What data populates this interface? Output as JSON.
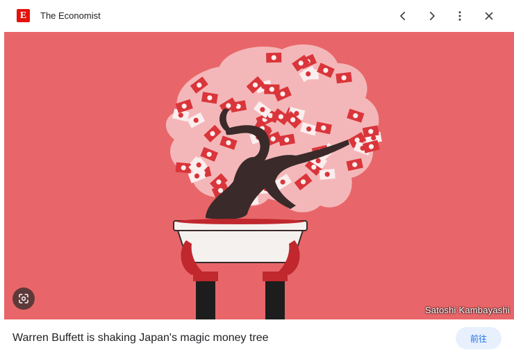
{
  "header": {
    "site_name": "The Economist",
    "favicon_letter": "E",
    "brand_color": "#e3120b",
    "prev_icon": "chevron-left-icon",
    "next_icon": "chevron-right-icon",
    "more_icon": "more-vert-icon",
    "close_icon": "close-icon"
  },
  "image": {
    "background_color": "#e86669",
    "credit": "Satoshi Kambayashi",
    "lens_icon": "lens-search-icon"
  },
  "footer": {
    "title": "Warren Buffett is shaking Japan's magic money tree",
    "visit_label": "前往",
    "accent": "#1a73e8"
  }
}
